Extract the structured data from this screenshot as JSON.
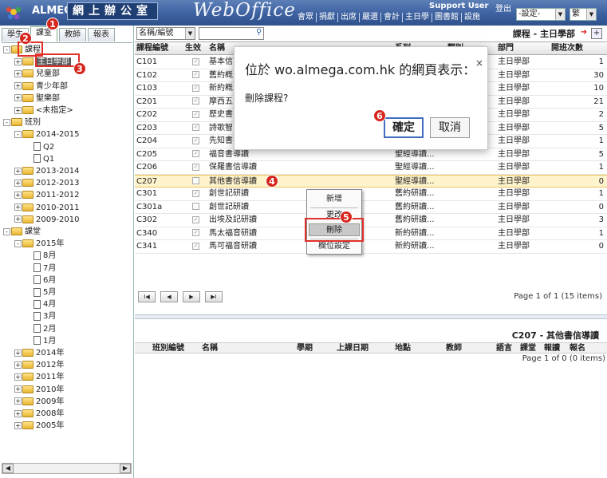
{
  "header": {
    "brand": "ALMEGA",
    "brand_cn": "網上辦公室",
    "product": "WebOffice",
    "nav": [
      "會眾",
      "捐獻",
      "出席",
      "嚴選",
      "會計",
      "主日學",
      "圖書館",
      "設施"
    ],
    "user": "Support User",
    "logout": "登出",
    "settings_select": "-設定-",
    "lang_select": "繁"
  },
  "left": {
    "tabs": [
      "學生",
      "課室",
      "教師",
      "報表"
    ],
    "tree": [
      {
        "label": "課程",
        "type": "folder",
        "level": 0,
        "pm": "-"
      },
      {
        "label": "主日學部",
        "type": "folder",
        "level": 1,
        "pm": "+",
        "selected": true
      },
      {
        "label": "兒童部",
        "type": "folder",
        "level": 1,
        "pm": "+"
      },
      {
        "label": "青少年部",
        "type": "folder",
        "level": 1,
        "pm": "+"
      },
      {
        "label": "聖樂部",
        "type": "folder",
        "level": 1,
        "pm": "+"
      },
      {
        "label": "<未指定>",
        "type": "folder",
        "level": 1,
        "pm": "+"
      },
      {
        "label": "班別",
        "type": "folder",
        "level": 0,
        "pm": "-"
      },
      {
        "label": "2014-2015",
        "type": "folder",
        "level": 1,
        "pm": "-"
      },
      {
        "label": "Q2",
        "type": "doc",
        "level": 2
      },
      {
        "label": "Q1",
        "type": "doc",
        "level": 2
      },
      {
        "label": "2013-2014",
        "type": "folder",
        "level": 1,
        "pm": "+"
      },
      {
        "label": "2012-2013",
        "type": "folder",
        "level": 1,
        "pm": "+"
      },
      {
        "label": "2011-2012",
        "type": "folder",
        "level": 1,
        "pm": "+"
      },
      {
        "label": "2010-2011",
        "type": "folder",
        "level": 1,
        "pm": "+"
      },
      {
        "label": "2009-2010",
        "type": "folder",
        "level": 1,
        "pm": "+"
      },
      {
        "label": "課堂",
        "type": "folder",
        "level": 0,
        "pm": "-"
      },
      {
        "label": "2015年",
        "type": "folder",
        "level": 1,
        "pm": "-"
      },
      {
        "label": "8月",
        "type": "doc",
        "level": 2
      },
      {
        "label": "7月",
        "type": "doc",
        "level": 2
      },
      {
        "label": "6月",
        "type": "doc",
        "level": 2
      },
      {
        "label": "5月",
        "type": "doc",
        "level": 2
      },
      {
        "label": "4月",
        "type": "doc",
        "level": 2
      },
      {
        "label": "3月",
        "type": "doc",
        "level": 2
      },
      {
        "label": "2月",
        "type": "doc",
        "level": 2
      },
      {
        "label": "1月",
        "type": "doc",
        "level": 2
      },
      {
        "label": "2014年",
        "type": "folder",
        "level": 1,
        "pm": "+"
      },
      {
        "label": "2012年",
        "type": "folder",
        "level": 1,
        "pm": "+"
      },
      {
        "label": "2011年",
        "type": "folder",
        "level": 1,
        "pm": "+"
      },
      {
        "label": "2010年",
        "type": "folder",
        "level": 1,
        "pm": "+"
      },
      {
        "label": "2009年",
        "type": "folder",
        "level": 1,
        "pm": "+"
      },
      {
        "label": "2008年",
        "type": "folder",
        "level": 1,
        "pm": "+"
      },
      {
        "label": "2005年",
        "type": "folder",
        "level": 1,
        "pm": "+"
      }
    ]
  },
  "toolbar": {
    "filter_select": "名稱/編號",
    "pane_title": "課程 - 主日學部"
  },
  "grid": {
    "columns": [
      "課程編號",
      "生效",
      "名稱",
      "系列",
      "類別",
      "部門",
      "開班次數"
    ],
    "rows": [
      {
        "code": "C101",
        "active": true,
        "name": "基本信...",
        "series": "",
        "dept": "主日學部",
        "count": "1"
      },
      {
        "code": "C102",
        "active": true,
        "name": "舊約概...",
        "series": "",
        "dept": "主日學部",
        "count": "30"
      },
      {
        "code": "C103",
        "active": true,
        "name": "新約概...",
        "series": "",
        "dept": "主日學部",
        "count": "10"
      },
      {
        "code": "C201",
        "active": true,
        "name": "摩西五...",
        "series": "",
        "dept": "主日學部",
        "count": "21"
      },
      {
        "code": "C202",
        "active": true,
        "name": "歷史書...",
        "series": "",
        "dept": "主日學部",
        "count": "2"
      },
      {
        "code": "C203",
        "active": true,
        "name": "詩歌智...",
        "series": "",
        "dept": "主日學部",
        "count": "5"
      },
      {
        "code": "C204",
        "active": true,
        "name": "先知書...",
        "series": "",
        "dept": "主日學部",
        "count": "1"
      },
      {
        "code": "C205",
        "active": true,
        "name": "福音書導讀",
        "series": "聖經導讀...",
        "dept": "主日學部",
        "count": "5"
      },
      {
        "code": "C206",
        "active": true,
        "name": "保羅書信導讀",
        "series": "聖經導讀...",
        "dept": "主日學部",
        "count": "1"
      },
      {
        "code": "C207",
        "active": false,
        "name": "其他書信導讀",
        "series": "聖經導讀...",
        "dept": "主日學部",
        "count": "0",
        "highlight": true
      },
      {
        "code": "C301",
        "active": true,
        "name": "創世記研讀",
        "series": "舊約研讀...",
        "dept": "主日學部",
        "count": "1"
      },
      {
        "code": "C301a",
        "active": false,
        "name": "創世記研讀",
        "series": "舊約研讀...",
        "dept": "主日學部",
        "count": "0"
      },
      {
        "code": "C302",
        "active": true,
        "name": "出埃及記研讀",
        "series": "舊約研讀...",
        "dept": "主日學部",
        "count": "3"
      },
      {
        "code": "C340",
        "active": true,
        "name": "馬太福音研讀",
        "series": "新約研讀...",
        "dept": "主日學部",
        "count": "1"
      },
      {
        "code": "C341",
        "active": true,
        "name": "馬可福音研讀",
        "series": "新約研讀...",
        "dept": "主日學部",
        "count": "0"
      }
    ],
    "pager_info": "Page 1 of 1 (15 items)"
  },
  "detail": {
    "title": "C207 - 其他書信導讀",
    "columns": [
      "班別編號",
      "名稱",
      "學期",
      "上課日期",
      "地點",
      "教師",
      "語言",
      "課堂",
      "報讀",
      "報名"
    ],
    "pager_info": "Page 1 of 0 (0 items)"
  },
  "context_menu": {
    "items": [
      "新增",
      "更改",
      "刪除",
      "欄位設定"
    ]
  },
  "dialog": {
    "title": "位於 wo.almega.com.hk 的網頁表示：",
    "close": "×",
    "message": "刪除課程?",
    "ok": "確定",
    "cancel": "取消"
  },
  "annotations": [
    "1",
    "2",
    "3",
    "4",
    "5",
    "6"
  ],
  "colors": {
    "header": "#3b5f9e",
    "highlight_row": "#fff3cc",
    "annotation": "#d7261e"
  }
}
